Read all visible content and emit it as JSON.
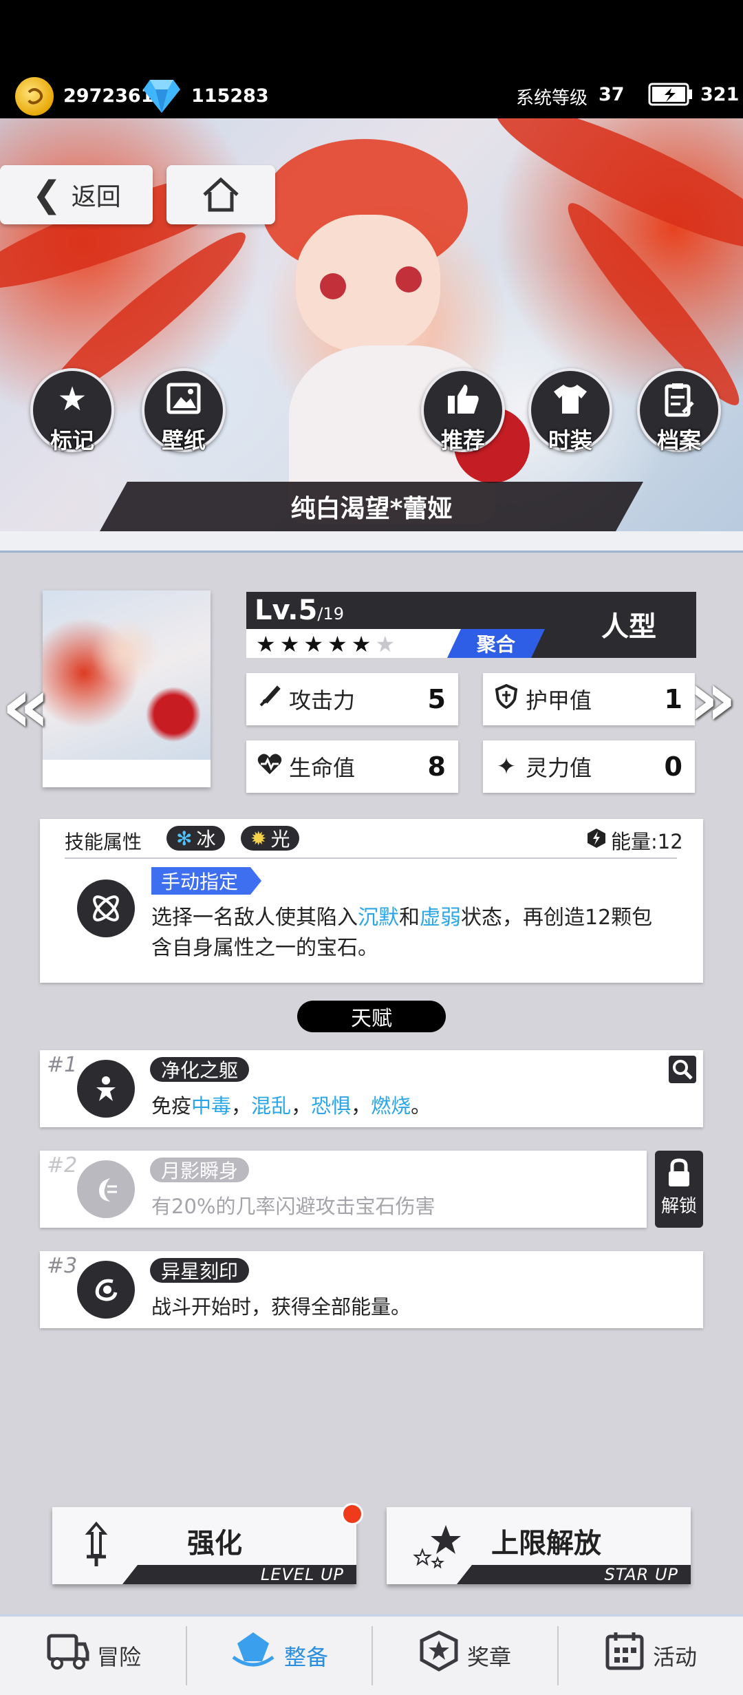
{
  "topbar": {
    "gold": "2972361",
    "diamond": "115283",
    "system_level_label": "系统等级",
    "system_level": "37",
    "stamina": "321"
  },
  "nav": {
    "back_label": "返回"
  },
  "actions": [
    {
      "label": "标记",
      "icon": "star-icon"
    },
    {
      "label": "壁纸",
      "icon": "image-icon"
    },
    {
      "label": "推荐",
      "icon": "thumbs-up-icon"
    },
    {
      "label": "时装",
      "icon": "shirt-icon"
    },
    {
      "label": "档案",
      "icon": "file-icon"
    }
  ],
  "character": {
    "name": "纯白渴望*蕾娅",
    "level_prefix": "Lv.",
    "level": "5",
    "level_max": "/19",
    "stars_filled": 5,
    "stars_total": 6,
    "trait": "聚合",
    "type": "人型"
  },
  "stats": [
    {
      "label": "攻击力",
      "value": "5",
      "icon": "sword-icon"
    },
    {
      "label": "护甲值",
      "value": "1",
      "icon": "shield-icon"
    },
    {
      "label": "生命值",
      "value": "8",
      "icon": "heart-icon"
    },
    {
      "label": "灵力值",
      "value": "0",
      "icon": "sparkle-icon"
    }
  ],
  "skill": {
    "attr_label": "技能属性",
    "elements": [
      "冰",
      "光"
    ],
    "energy_label": "能量:12",
    "tag": "手动指定",
    "desc_1": "选择一名敌人使其陷入",
    "kw_1": "沉默",
    "and": "和",
    "kw_2": "虚弱",
    "desc_2": "状态，再创造12颗包",
    "desc_3": "含自身属性之一的宝石。"
  },
  "talent": {
    "title": "天赋",
    "items": [
      {
        "num": "#1",
        "name": "净化之躯",
        "prefix": "免疫",
        "kws": [
          "中毒",
          "混乱",
          "恐惧",
          "燃烧"
        ],
        "sep": "，",
        "end": "。"
      },
      {
        "num": "#2",
        "name": "月影瞬身",
        "desc": "有20%的几率闪避攻击宝石伤害",
        "unlock_label": "解锁"
      },
      {
        "num": "#3",
        "name": "异星刻印",
        "desc": "战斗开始时，获得全部能量。"
      }
    ]
  },
  "buttons": {
    "upgrade_label": "强化",
    "upgrade_sub": "LEVEL UP",
    "limit_label": "上限解放",
    "limit_sub": "STAR UP"
  },
  "bottom_nav": [
    "冒险",
    "整备",
    "奖章",
    "活动"
  ],
  "colors": {
    "accent_blue": "#2f5ee6",
    "keyword_blue": "#2aa6e8",
    "badge_red": "#f03a1c"
  }
}
